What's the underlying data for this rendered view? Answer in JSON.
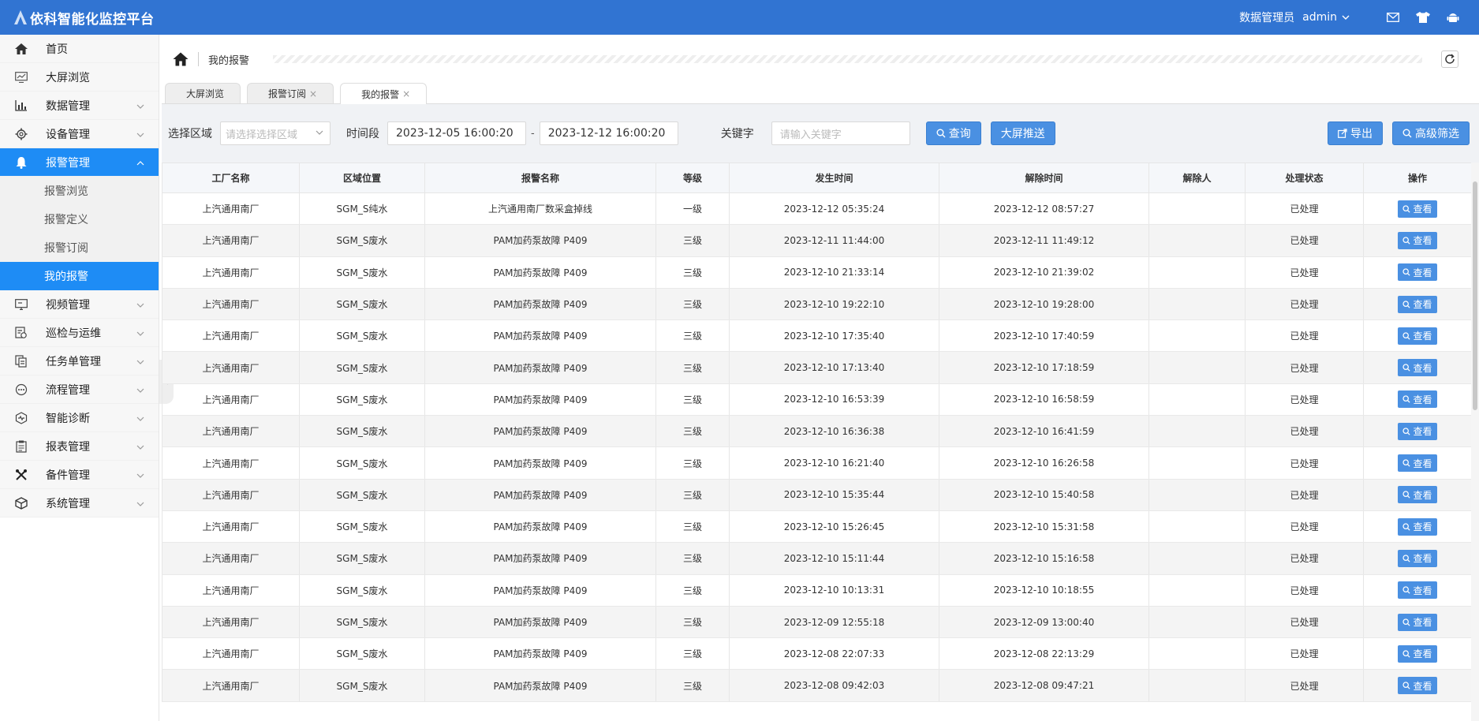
{
  "app": {
    "title": "依科智能化监控平台"
  },
  "user": {
    "role": "数据管理员",
    "name": "admin"
  },
  "top_icons": [
    "mail-icon",
    "shirt-icon",
    "android-icon"
  ],
  "sidebar": {
    "items": [
      {
        "label": "首页",
        "icon": "home-icon",
        "arrow": false
      },
      {
        "label": "大屏浏览",
        "icon": "screen-icon",
        "arrow": false
      },
      {
        "label": "数据管理",
        "icon": "bar-chart-icon",
        "arrow": true
      },
      {
        "label": "设备管理",
        "icon": "gear-icon",
        "arrow": true
      },
      {
        "label": "报警管理",
        "icon": "bell-icon",
        "arrow": true,
        "active": true,
        "children": [
          {
            "label": "报警浏览"
          },
          {
            "label": "报警定义"
          },
          {
            "label": "报警订阅"
          },
          {
            "label": "我的报警",
            "active": true
          }
        ]
      },
      {
        "label": "视频管理",
        "icon": "monitor-icon",
        "arrow": true
      },
      {
        "label": "巡检与运维",
        "icon": "inspection-icon",
        "arrow": true
      },
      {
        "label": "任务单管理",
        "icon": "task-icon",
        "arrow": true
      },
      {
        "label": "流程管理",
        "icon": "flow-icon",
        "arrow": true
      },
      {
        "label": "智能诊断",
        "icon": "diagnosis-icon",
        "arrow": true
      },
      {
        "label": "报表管理",
        "icon": "report-icon",
        "arrow": true
      },
      {
        "label": "备件管理",
        "icon": "tools-icon",
        "arrow": true
      },
      {
        "label": "系统管理",
        "icon": "cube-icon",
        "arrow": true
      }
    ]
  },
  "breadcrumb": {
    "current": "我的报警"
  },
  "tabs": [
    {
      "label": "大屏浏览",
      "closable": false
    },
    {
      "label": "报警订阅",
      "closable": true
    },
    {
      "label": "我的报警",
      "closable": true,
      "active": true
    }
  ],
  "filters": {
    "area_label": "选择区域",
    "area_placeholder": "请选择选择区域",
    "time_label": "时间段",
    "time_start": "2023-12-05 16:00:20",
    "time_sep": "-",
    "time_end": "2023-12-12 16:00:20",
    "keyword_label": "关键字",
    "keyword_placeholder": "请输入关键字",
    "query_btn": "查询",
    "push_btn": "大屏推送",
    "export_btn": "导出",
    "advanced_btn": "高级筛选"
  },
  "table": {
    "columns": [
      "工厂名称",
      "区域位置",
      "报警名称",
      "等级",
      "发生时间",
      "解除时间",
      "解除人",
      "处理状态",
      "操作"
    ],
    "view_label": "查看",
    "rows": [
      [
        "上汽通用南厂",
        "SGM_S纯水",
        "上汽通用南厂数采盒掉线",
        "一级",
        "2023-12-12 05:35:24",
        "2023-12-12 08:57:27",
        "",
        "已处理"
      ],
      [
        "上汽通用南厂",
        "SGM_S废水",
        "PAM加药泵故障 P409",
        "三级",
        "2023-12-11 11:44:00",
        "2023-12-11 11:49:12",
        "",
        "已处理"
      ],
      [
        "上汽通用南厂",
        "SGM_S废水",
        "PAM加药泵故障 P409",
        "三级",
        "2023-12-10 21:33:14",
        "2023-12-10 21:39:02",
        "",
        "已处理"
      ],
      [
        "上汽通用南厂",
        "SGM_S废水",
        "PAM加药泵故障 P409",
        "三级",
        "2023-12-10 19:22:10",
        "2023-12-10 19:28:00",
        "",
        "已处理"
      ],
      [
        "上汽通用南厂",
        "SGM_S废水",
        "PAM加药泵故障 P409",
        "三级",
        "2023-12-10 17:35:40",
        "2023-12-10 17:40:59",
        "",
        "已处理"
      ],
      [
        "上汽通用南厂",
        "SGM_S废水",
        "PAM加药泵故障 P409",
        "三级",
        "2023-12-10 17:13:40",
        "2023-12-10 17:18:59",
        "",
        "已处理"
      ],
      [
        "上汽通用南厂",
        "SGM_S废水",
        "PAM加药泵故障 P409",
        "三级",
        "2023-12-10 16:53:39",
        "2023-12-10 16:58:59",
        "",
        "已处理"
      ],
      [
        "上汽通用南厂",
        "SGM_S废水",
        "PAM加药泵故障 P409",
        "三级",
        "2023-12-10 16:36:38",
        "2023-12-10 16:41:59",
        "",
        "已处理"
      ],
      [
        "上汽通用南厂",
        "SGM_S废水",
        "PAM加药泵故障 P409",
        "三级",
        "2023-12-10 16:21:40",
        "2023-12-10 16:26:58",
        "",
        "已处理"
      ],
      [
        "上汽通用南厂",
        "SGM_S废水",
        "PAM加药泵故障 P409",
        "三级",
        "2023-12-10 15:35:44",
        "2023-12-10 15:40:58",
        "",
        "已处理"
      ],
      [
        "上汽通用南厂",
        "SGM_S废水",
        "PAM加药泵故障 P409",
        "三级",
        "2023-12-10 15:26:45",
        "2023-12-10 15:31:58",
        "",
        "已处理"
      ],
      [
        "上汽通用南厂",
        "SGM_S废水",
        "PAM加药泵故障 P409",
        "三级",
        "2023-12-10 15:11:44",
        "2023-12-10 15:16:58",
        "",
        "已处理"
      ],
      [
        "上汽通用南厂",
        "SGM_S废水",
        "PAM加药泵故障 P409",
        "三级",
        "2023-12-10 10:13:31",
        "2023-12-10 10:18:55",
        "",
        "已处理"
      ],
      [
        "上汽通用南厂",
        "SGM_S废水",
        "PAM加药泵故障 P409",
        "三级",
        "2023-12-09 12:55:18",
        "2023-12-09 13:00:40",
        "",
        "已处理"
      ],
      [
        "上汽通用南厂",
        "SGM_S废水",
        "PAM加药泵故障 P409",
        "三级",
        "2023-12-08 22:07:33",
        "2023-12-08 22:13:29",
        "",
        "已处理"
      ],
      [
        "上汽通用南厂",
        "SGM_S废水",
        "PAM加药泵故障 P409",
        "三级",
        "2023-12-08 09:42:03",
        "2023-12-08 09:47:21",
        "",
        "已处理"
      ]
    ]
  }
}
